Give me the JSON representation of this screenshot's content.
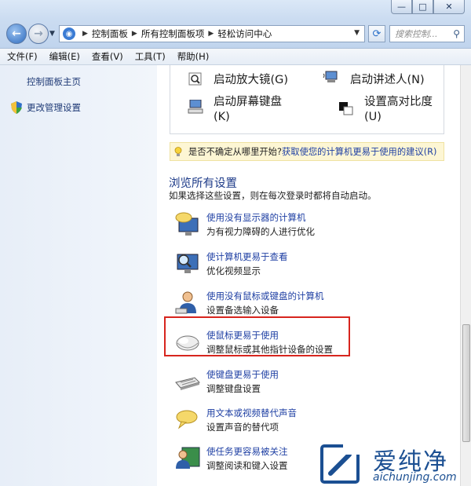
{
  "window": {
    "minimize_glyph": "—",
    "maximize_glyph": "□",
    "close_glyph": "✕"
  },
  "address": {
    "crumbs": [
      "控制面板",
      "所有控制面板项",
      "轻松访问中心"
    ],
    "search_placeholder": "搜索控制..."
  },
  "menu": [
    "文件(F)",
    "编辑(E)",
    "查看(V)",
    "工具(T)",
    "帮助(H)"
  ],
  "left_nav": {
    "home": "控制面板主页",
    "admin": "更改管理设置"
  },
  "quick_access": [
    {
      "label": "启动放大镜(G)",
      "icon": "magnifier-icon"
    },
    {
      "label": "启动讲述人(N)",
      "icon": "narrator-icon"
    },
    {
      "label_line1": "启动屏幕键盘",
      "label_line2": "(K)",
      "icon": "onscreen-keyboard-icon"
    },
    {
      "label_line1": "设置高对比度",
      "label_line2": "(U)",
      "icon": "high-contrast-icon"
    }
  ],
  "tip": {
    "text": "是否不确定从哪里开始?",
    "link": "获取使您的计算机更易于使用的建议(R)"
  },
  "browse": {
    "title": "浏览所有设置",
    "desc": "如果选择这些设置，则在每次登录时都将自动启动。"
  },
  "settings": [
    {
      "link": "使用没有显示器的计算机",
      "desc": "为有视力障碍的人进行优化",
      "icon": "monitor-speech-icon"
    },
    {
      "link": "使计算机更易于查看",
      "desc": "优化视频显示",
      "icon": "monitor-magnify-icon"
    },
    {
      "link": "使用没有鼠标或键盘的计算机",
      "desc": "设置备选输入设备",
      "icon": "person-keyboard-icon"
    },
    {
      "link": "使鼠标更易于使用",
      "desc": "调整鼠标或其他指针设备的设置",
      "icon": "mouse-icon"
    },
    {
      "link": "使键盘更易于使用",
      "desc": "调整键盘设置",
      "icon": "keyboard-icon"
    },
    {
      "link": "用文本或视频替代声音",
      "desc": "设置声音的替代项",
      "icon": "speech-bubble-icon"
    },
    {
      "link": "使任务更容易被关注",
      "desc": "调整阅读和键入设置",
      "icon": "person-focus-icon"
    }
  ],
  "watermark": {
    "brand": "爱纯净",
    "url": "aichunjing.com"
  },
  "colors": {
    "link": "#1e3fa3",
    "highlight": "#d7251e",
    "section_title": "#1c3a88"
  }
}
